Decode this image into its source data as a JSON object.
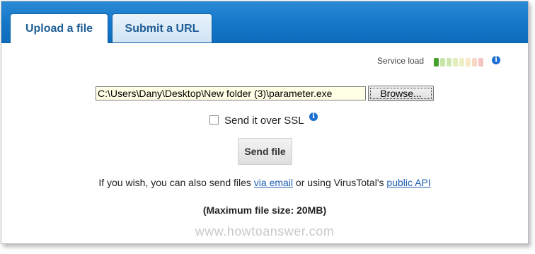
{
  "tabs": {
    "upload_label": "Upload a file",
    "url_label": "Submit a URL"
  },
  "service": {
    "label": "Service load",
    "bar_colors": [
      "#44a12c",
      "#c9e6a9",
      "#cfe8b0",
      "#e3eebd",
      "#eef0c4",
      "#f6e9c4",
      "#f6d8c4",
      "#f3c4c2"
    ],
    "info_icon": "info-icon"
  },
  "upload": {
    "file_path": "C:\\Users\\Dany\\Desktop\\New folder (3)\\parameter.exe",
    "browse_label": "Browse..."
  },
  "ssl": {
    "label": "Send it over SSL",
    "checked": false
  },
  "send_button": "Send file",
  "alt_send": {
    "prefix": "If you wish, you can also send files ",
    "email_link": "via email",
    "middle": " or using VirusTotal's ",
    "api_link": "public API"
  },
  "max_size": "(Maximum file size: 20MB)",
  "watermark": "www.howtoanswer.com",
  "colors": {
    "accent": "#1476c8",
    "link": "#1e5fb5",
    "info": "#1b6fd0"
  }
}
